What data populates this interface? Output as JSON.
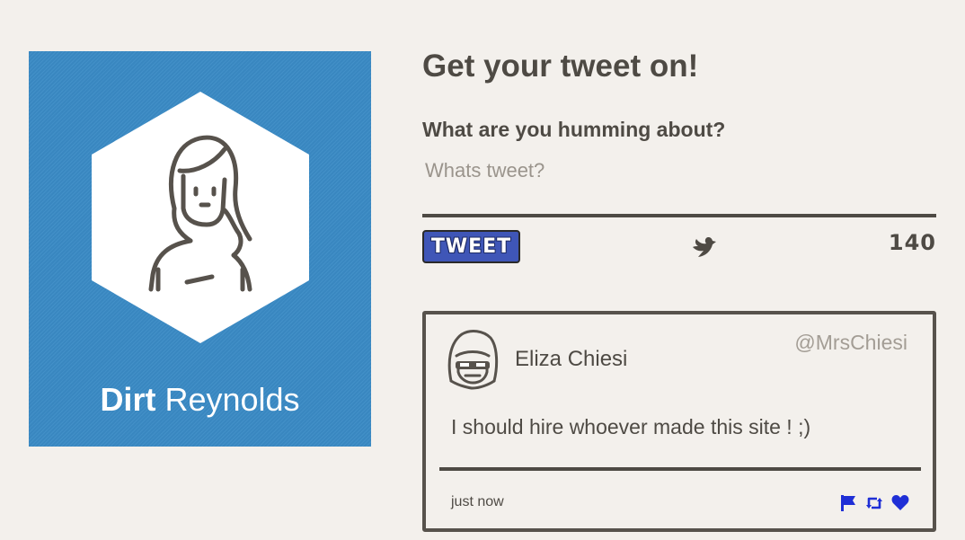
{
  "profile": {
    "first_name": "Dirt",
    "last_name": "Reynolds",
    "card_color": "#3b8bc6"
  },
  "compose": {
    "title": "Get your tweet on!",
    "question": "What are you humming about?",
    "placeholder": "Whats tweet?",
    "tweet_button_label": "TWEET",
    "char_count": "140",
    "icon": "bird-icon",
    "button_color": "#3f56b7"
  },
  "tweet": {
    "author_name": "Eliza Chiesi",
    "handle": "@MrsChiesi",
    "text": "I should hire whoever made this site ! ;)",
    "timestamp": "just now",
    "actions": [
      "flag-icon",
      "retweet-icon",
      "heart-icon"
    ],
    "action_color": "#1f2fd6"
  }
}
